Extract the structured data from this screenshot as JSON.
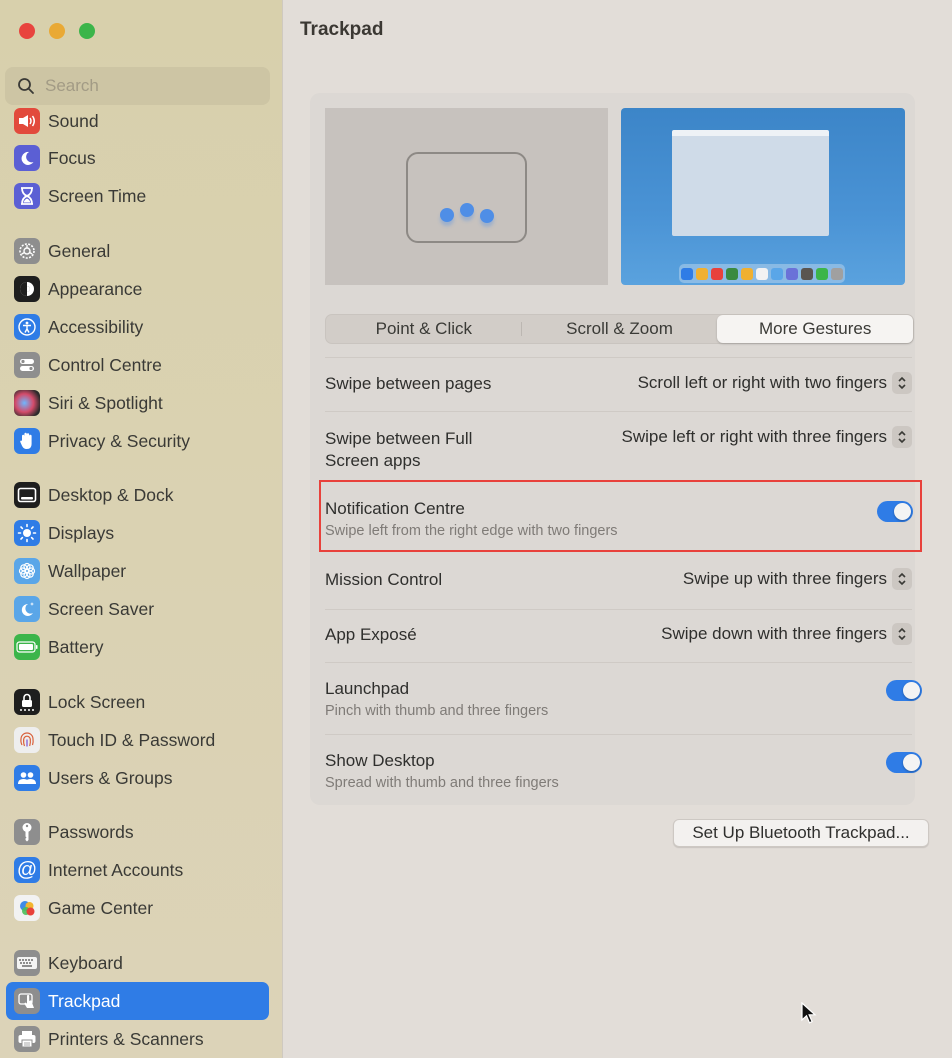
{
  "window": {
    "title": "Trackpad",
    "controls": [
      "close",
      "minimize",
      "maximize"
    ]
  },
  "search": {
    "placeholder": "Search",
    "value": ""
  },
  "sidebar": {
    "items": [
      {
        "label": "Sound",
        "icon": "speaker-icon",
        "color": "#e24a3c"
      },
      {
        "label": "Focus",
        "icon": "moon-icon",
        "color": "#5b5fd4"
      },
      {
        "label": "Screen Time",
        "icon": "hourglass-icon",
        "color": "#5b5fd4"
      },
      {
        "label": "General",
        "icon": "gear-icon",
        "color": "#8e8e8e"
      },
      {
        "label": "Appearance",
        "icon": "appearance-icon",
        "color": "#1e1e1e"
      },
      {
        "label": "Accessibility",
        "icon": "accessibility-icon",
        "color": "#2f7ce6"
      },
      {
        "label": "Control Centre",
        "icon": "control-centre-icon",
        "color": "#8e8e8e"
      },
      {
        "label": "Siri & Spotlight",
        "icon": "siri-icon",
        "color": "#3a3a3a"
      },
      {
        "label": "Privacy & Security",
        "icon": "hand-icon",
        "color": "#2f7ce6"
      },
      {
        "label": "Desktop & Dock",
        "icon": "dock-icon",
        "color": "#1e1e1e"
      },
      {
        "label": "Displays",
        "icon": "sun-icon",
        "color": "#2f7ce6"
      },
      {
        "label": "Wallpaper",
        "icon": "flower-icon",
        "color": "#5aa6e8"
      },
      {
        "label": "Screen Saver",
        "icon": "screensaver-moon-icon",
        "color": "#5aa6e8"
      },
      {
        "label": "Battery",
        "icon": "battery-icon",
        "color": "#3cb54a"
      },
      {
        "label": "Lock Screen",
        "icon": "lock-icon",
        "color": "#1e1e1e"
      },
      {
        "label": "Touch ID & Password",
        "icon": "fingerprint-icon",
        "color": "#eeeeee"
      },
      {
        "label": "Users & Groups",
        "icon": "users-icon",
        "color": "#2f7ce6"
      },
      {
        "label": "Passwords",
        "icon": "key-icon",
        "color": "#8e8e8e"
      },
      {
        "label": "Internet Accounts",
        "icon": "at-icon",
        "color": "#2f7ce6"
      },
      {
        "label": "Game Center",
        "icon": "game-center-icon",
        "color": "#f2f2f2"
      },
      {
        "label": "Keyboard",
        "icon": "keyboard-icon",
        "color": "#8e8e8e"
      },
      {
        "label": "Trackpad",
        "icon": "trackpad-icon",
        "color": "#8e8e8e",
        "selected": true
      },
      {
        "label": "Printers & Scanners",
        "icon": "printer-icon",
        "color": "#8e8e8e"
      }
    ]
  },
  "main": {
    "title": "Trackpad",
    "tabs": [
      {
        "label": "Point & Click",
        "selected": false
      },
      {
        "label": "Scroll & Zoom",
        "selected": false
      },
      {
        "label": "More Gestures",
        "selected": true
      }
    ],
    "settings": [
      {
        "label": "Swipe between pages",
        "type": "popup",
        "value": "Scroll left or right with two fingers"
      },
      {
        "label": "Swipe between Full Screen apps",
        "label_lines": [
          "Swipe between Full",
          "Screen apps"
        ],
        "type": "popup",
        "value": "Swipe left or right with three fingers"
      },
      {
        "label": "Notification Centre",
        "type": "toggle",
        "subtitle": "Swipe left from the right edge with two fingers",
        "on": true,
        "highlighted": true
      },
      {
        "label": "Mission Control",
        "type": "popup",
        "value": "Swipe up with three fingers"
      },
      {
        "label": "App Exposé",
        "type": "popup",
        "value": "Swipe down with three fingers"
      },
      {
        "label": "Launchpad",
        "type": "toggle",
        "subtitle": "Pinch with thumb and three fingers",
        "on": true
      },
      {
        "label": "Show Desktop",
        "type": "toggle",
        "subtitle": "Spread with thumb and three fingers",
        "on": true
      }
    ],
    "bluetooth_button": "Set Up Bluetooth Trackpad..."
  },
  "colors": {
    "accent": "#2f7ce6",
    "highlight_border": "#e8413b",
    "sidebar_bg": "#d9d1b0",
    "content_bg": "#e2ddd8"
  }
}
